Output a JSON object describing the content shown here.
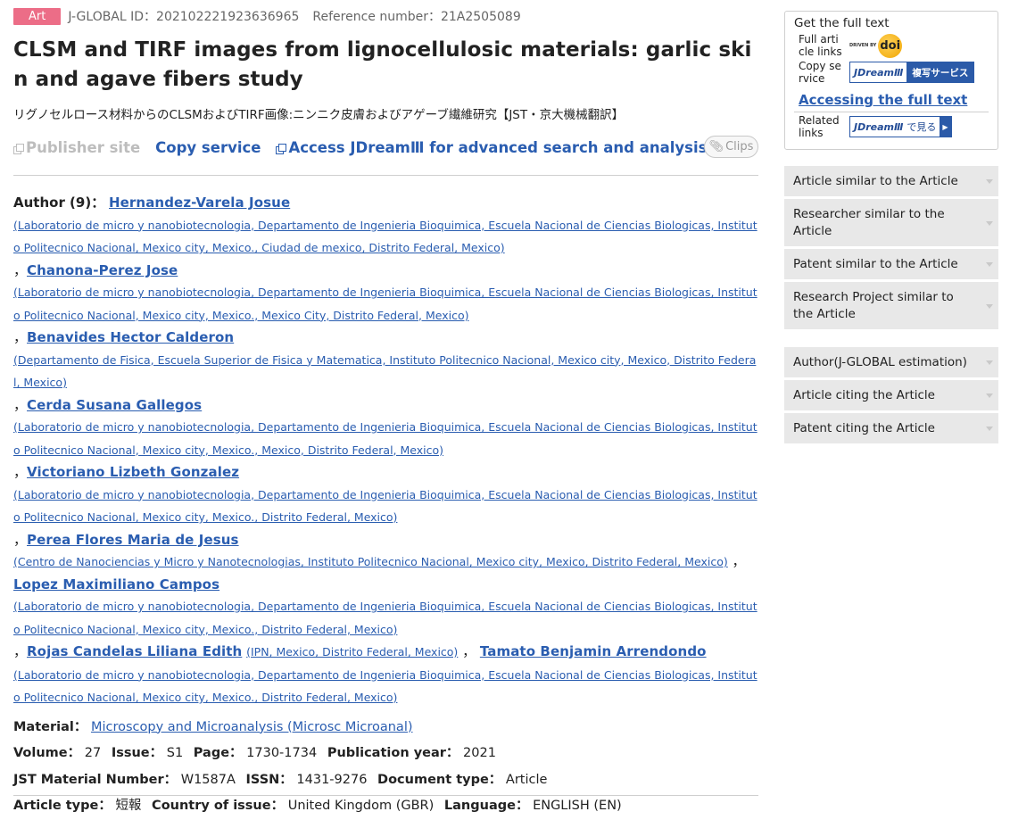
{
  "meta": {
    "badge": "Art",
    "jglobal_id": "J-GLOBAL ID：202102221923636965",
    "reference_number": "Reference number：21A2505089"
  },
  "title": "CLSM and TIRF images from lignocellulosic materials: garlic skin and agave fibers study",
  "japanese_title": "リグノセルロース材料からのCLSMおよびTIRF画像:ニンニク皮膚およびアゲーブ繊維研究【JST・京大機械翻訳】",
  "actions": {
    "publisher_site": "Publisher site",
    "copy_service": "Copy service",
    "access_jdream": "Access JDreamⅢ for advanced search and analysis.",
    "clips": "Clips"
  },
  "authors": {
    "label": "Author (9)：",
    "list": [
      {
        "name": "Hernandez-Varela Josue",
        "affiliation": "(Laboratorio de micro y nanobiotecnologia, Departamento de Ingenieria Bioquimica, Escuela Nacional de Ciencias Biologicas, Instituto Politecnico Nacional, Mexico city, Mexico., Ciudad de mexico, Distrito Federal, Mexico)"
      },
      {
        "name": "Chanona-Perez Jose",
        "affiliation": "(Laboratorio de micro y nanobiotecnologia, Departamento de Ingenieria Bioquimica, Escuela Nacional de Ciencias Biologicas, Instituto Politecnico Nacional, Mexico city, Mexico., Mexico City, Distrito Federal, Mexico)"
      },
      {
        "name": "Benavides Hector Calderon",
        "affiliation": "(Departamento de Fisica, Escuela Superior de Fisica y Matematica, Instituto Politecnico Nacional, Mexico city, Mexico, Distrito Federal, Mexico)"
      },
      {
        "name": "Cerda Susana Gallegos",
        "affiliation": "(Laboratorio de micro y nanobiotecnologia, Departamento de Ingenieria Bioquimica, Escuela Nacional de Ciencias Biologicas, Instituto Politecnico Nacional, Mexico city, Mexico., Mexico, Distrito Federal, Mexico)"
      },
      {
        "name": "Victoriano Lizbeth Gonzalez",
        "affiliation": "(Laboratorio de micro y nanobiotecnologia, Departamento de Ingenieria Bioquimica, Escuela Nacional de Ciencias Biologicas, Instituto Politecnico Nacional, Mexico city, Mexico., Distrito Federal, Mexico)"
      },
      {
        "name": "Perea Flores Maria de Jesus",
        "affiliation": "(Centro de Nanociencias y Micro y Nanotecnologias, Instituto Politecnico Nacional, Mexico city, Mexico, Distrito Federal, Mexico)"
      },
      {
        "name": "Lopez Maximiliano Campos",
        "affiliation": "(Laboratorio de micro y nanobiotecnologia, Departamento de Ingenieria Bioquimica, Escuela Nacional de Ciencias Biologicas, Instituto Politecnico Nacional, Mexico city, Mexico., Distrito Federal, Mexico)"
      },
      {
        "name": "Rojas Candelas Liliana Edith",
        "affiliation": "(IPN, Mexico, Distrito Federal, Mexico)"
      },
      {
        "name": "Tamato Benjamin Arrendondo",
        "affiliation": "(Laboratorio de micro y nanobiotecnologia, Departamento de Ingenieria Bioquimica, Escuela Nacional de Ciencias Biologicas, Instituto Politecnico Nacional, Mexico city, Mexico., Distrito Federal, Mexico)"
      }
    ]
  },
  "fields": {
    "material_label": "Material：",
    "material_value": "Microscopy and Microanalysis (Microsc Microanal)",
    "volume_label": "Volume：",
    "volume_value": "27",
    "issue_label": "Issue：",
    "issue_value": "S1",
    "page_label": "Page：",
    "page_value": "1730-1734",
    "pubyear_label": "Publication year：",
    "pubyear_value": "2021",
    "jst_label": "JST Material Number：",
    "jst_value": "W1587A",
    "issn_label": "ISSN：",
    "issn_value": "1431-9276",
    "doctype_label": "Document type：",
    "doctype_value": "Article",
    "arttype_label": "Article type：",
    "arttype_value": "短報",
    "country_label": "Country of issue：",
    "country_value": "United Kingdom (GBR)",
    "lang_label": "Language：",
    "lang_value": "ENGLISH (EN)"
  },
  "sidebar": {
    "full_text_heading": "Get the full text",
    "full_article_links_label": "Full article links",
    "doi_driven_by": "DRIVEN BY",
    "doi_logo": "doi",
    "copy_service_label": "Copy service",
    "jdream_logo": "JDreamⅢ",
    "jdream_copy_text": "複写サービス",
    "accessing_full_text": "Accessing the full text",
    "related_links_label": "Related links",
    "jdream_view_text": "で見る",
    "menu_group_1": [
      "Article similar to the Article",
      "Researcher similar to the Article",
      "Patent similar to the Article",
      "Research Project similar to the Article"
    ],
    "menu_group_2": [
      "Author(J-GLOBAL estimation)",
      "Article citing the Article",
      "Patent citing the Article"
    ]
  },
  "colors": {
    "badge": "#ec6d87",
    "link": "#2a5db0",
    "menu_bg": "#e8e8e8",
    "jdream_blue": "#2b5aa8"
  }
}
